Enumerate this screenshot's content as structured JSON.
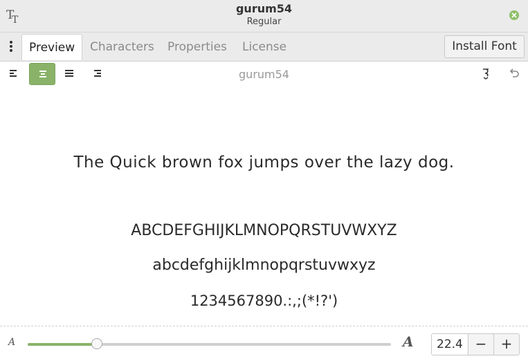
{
  "window": {
    "title": "gurum54",
    "subtitle": "Regular",
    "app_icon": "font-tt-icon",
    "close_icon": "close-icon",
    "accent_color": "#8ab369"
  },
  "tabs": [
    {
      "label": "Preview",
      "active": true
    },
    {
      "label": "Characters",
      "active": false
    },
    {
      "label": "Properties",
      "active": false
    },
    {
      "label": "License",
      "active": false
    }
  ],
  "install_label": "Install Font",
  "toolbar": {
    "preview_name": "gurum54",
    "alignment_selected": "center",
    "alignment_icons": [
      "align-left-icon",
      "align-center-icon",
      "align-fill-icon",
      "align-right-icon"
    ],
    "right_icons": [
      "glyph-menu-icon",
      "undo-icon"
    ]
  },
  "preview": {
    "pangram": "The Quick brown fox jumps over the lazy dog.",
    "uppercase": "ABCDEFGHIJKLMNOPQRSTUVWXYZ",
    "lowercase": "abcdefghijklmnopqrstuvwxyz",
    "digits": "1234567890.:,;(*!?')"
  },
  "size": {
    "min_label": "A",
    "max_label": "A",
    "value": "22.4",
    "slider_fraction": 0.19,
    "decrement": "−",
    "increment": "+"
  }
}
